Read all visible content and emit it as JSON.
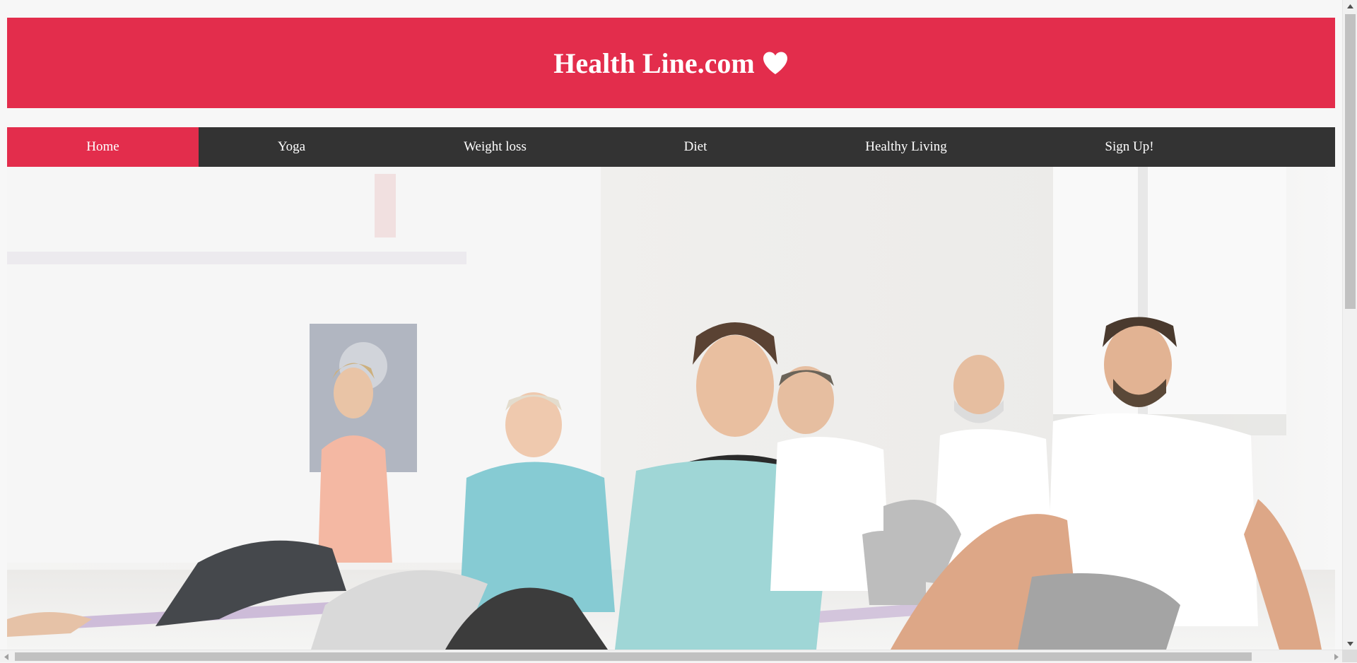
{
  "header": {
    "title": "Health Line.com",
    "icon": "heart-icon",
    "background_color": "#e32d4c"
  },
  "nav": {
    "background_color": "#333333",
    "active_color": "#e32d4c",
    "items": [
      {
        "label": "Home",
        "active": true
      },
      {
        "label": "Yoga",
        "active": false
      },
      {
        "label": "Weight loss",
        "active": false
      },
      {
        "label": "Diet",
        "active": false
      },
      {
        "label": "Healthy Living",
        "active": false
      },
      {
        "label": "Sign Up!",
        "active": false
      }
    ]
  },
  "hero": {
    "image": "group-yoga-class-photo"
  },
  "scrollbars": {
    "vertical": true,
    "horizontal": true
  }
}
